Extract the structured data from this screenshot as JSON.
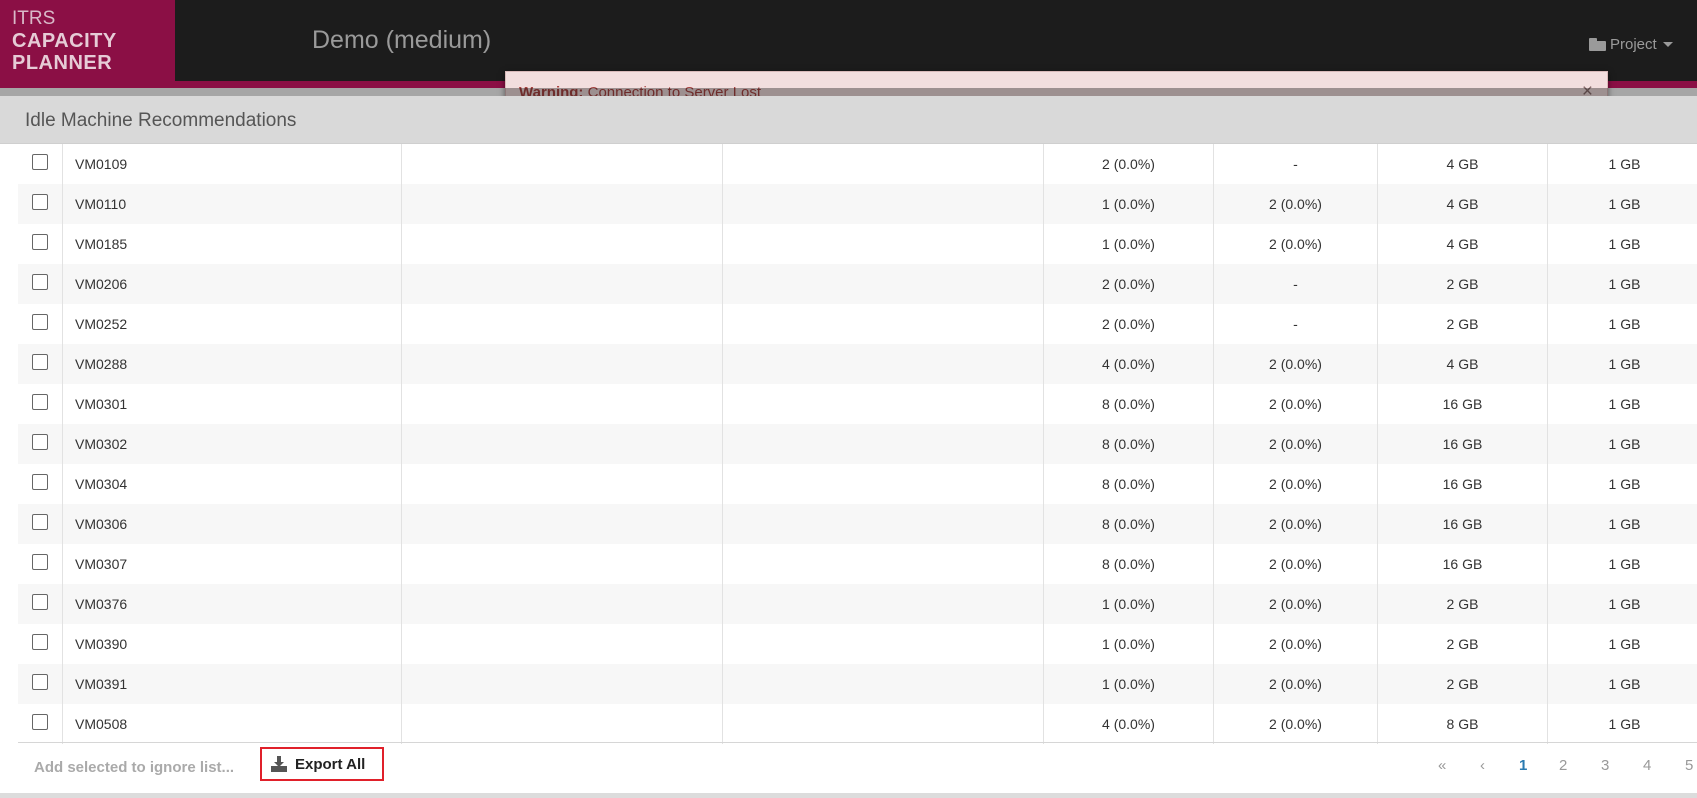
{
  "navbar": {
    "logo_line1": "ITRS",
    "logo_line2": "CAPACITY",
    "logo_line3": "PLANNER",
    "app_title": "Demo (medium)",
    "project_menu_label": "Project",
    "project_icon": "folder-icon",
    "accent_color": "#8b0f45"
  },
  "warning": {
    "label": "Warning:",
    "message": "Connection to Server Lost",
    "close": "×"
  },
  "modal": {
    "title": "Idle Machine Recommendations"
  },
  "table": {
    "rows": [
      {
        "name": "VM0109",
        "col_a": "",
        "col_b": "",
        "cpu": "2 (0.0%)",
        "cpu2": "-",
        "mem": "4 GB",
        "mem2": "1 GB"
      },
      {
        "name": "VM0110",
        "col_a": "",
        "col_b": "",
        "cpu": "1 (0.0%)",
        "cpu2": "2 (0.0%)",
        "mem": "4 GB",
        "mem2": "1 GB"
      },
      {
        "name": "VM0185",
        "col_a": "",
        "col_b": "",
        "cpu": "1 (0.0%)",
        "cpu2": "2 (0.0%)",
        "mem": "4 GB",
        "mem2": "1 GB"
      },
      {
        "name": "VM0206",
        "col_a": "",
        "col_b": "",
        "cpu": "2 (0.0%)",
        "cpu2": "-",
        "mem": "2 GB",
        "mem2": "1 GB"
      },
      {
        "name": "VM0252",
        "col_a": "",
        "col_b": "",
        "cpu": "2 (0.0%)",
        "cpu2": "-",
        "mem": "2 GB",
        "mem2": "1 GB"
      },
      {
        "name": "VM0288",
        "col_a": "",
        "col_b": "",
        "cpu": "4 (0.0%)",
        "cpu2": "2 (0.0%)",
        "mem": "4 GB",
        "mem2": "1 GB"
      },
      {
        "name": "VM0301",
        "col_a": "",
        "col_b": "",
        "cpu": "8 (0.0%)",
        "cpu2": "2 (0.0%)",
        "mem": "16 GB",
        "mem2": "1 GB"
      },
      {
        "name": "VM0302",
        "col_a": "",
        "col_b": "",
        "cpu": "8 (0.0%)",
        "cpu2": "2 (0.0%)",
        "mem": "16 GB",
        "mem2": "1 GB"
      },
      {
        "name": "VM0304",
        "col_a": "",
        "col_b": "",
        "cpu": "8 (0.0%)",
        "cpu2": "2 (0.0%)",
        "mem": "16 GB",
        "mem2": "1 GB"
      },
      {
        "name": "VM0306",
        "col_a": "",
        "col_b": "",
        "cpu": "8 (0.0%)",
        "cpu2": "2 (0.0%)",
        "mem": "16 GB",
        "mem2": "1 GB"
      },
      {
        "name": "VM0307",
        "col_a": "",
        "col_b": "",
        "cpu": "8 (0.0%)",
        "cpu2": "2 (0.0%)",
        "mem": "16 GB",
        "mem2": "1 GB"
      },
      {
        "name": "VM0376",
        "col_a": "",
        "col_b": "",
        "cpu": "1 (0.0%)",
        "cpu2": "2 (0.0%)",
        "mem": "2 GB",
        "mem2": "1 GB"
      },
      {
        "name": "VM0390",
        "col_a": "",
        "col_b": "",
        "cpu": "1 (0.0%)",
        "cpu2": "2 (0.0%)",
        "mem": "2 GB",
        "mem2": "1 GB"
      },
      {
        "name": "VM0391",
        "col_a": "",
        "col_b": "",
        "cpu": "1 (0.0%)",
        "cpu2": "2 (0.0%)",
        "mem": "2 GB",
        "mem2": "1 GB"
      },
      {
        "name": "VM0508",
        "col_a": "",
        "col_b": "",
        "cpu": "4 (0.0%)",
        "cpu2": "2 (0.0%)",
        "mem": "8 GB",
        "mem2": "1 GB"
      }
    ]
  },
  "footer": {
    "ignore_label": "Add selected to ignore list...",
    "export_label": "Export All",
    "export_icon": "download-icon",
    "pagination": {
      "first": "«",
      "prev": "‹",
      "pages": [
        "1",
        "2",
        "3",
        "4",
        "5"
      ],
      "active_page": "1"
    }
  }
}
